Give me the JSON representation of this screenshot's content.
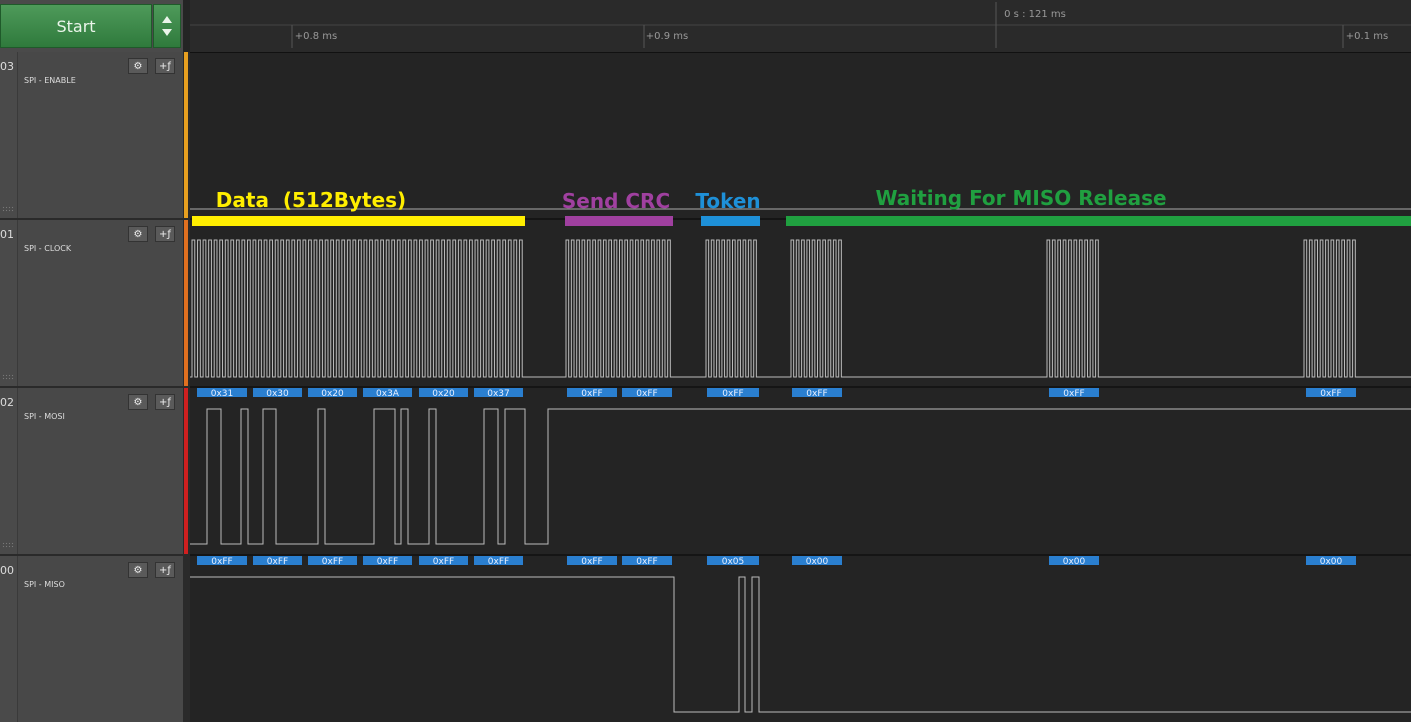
{
  "toolbar": {
    "start_label": "Start"
  },
  "timeline": {
    "absolute_time": "0 s : 121 ms",
    "ticks": [
      "+0.8 ms",
      "+0.9 ms",
      "+0.1 ms"
    ]
  },
  "channels": [
    {
      "index": "03",
      "name": "SPI - ENABLE"
    },
    {
      "index": "01",
      "name": "SPI - CLOCK"
    },
    {
      "index": "02",
      "name": "SPI - MOSI"
    },
    {
      "index": "00",
      "name": "SPI - MISO"
    }
  ],
  "annotations": [
    {
      "label": "Data  (512Bytes)",
      "color": "#ffee00"
    },
    {
      "label": "Send CRC",
      "color": "#a040a0"
    },
    {
      "label": "Token",
      "color": "#1e90d8"
    },
    {
      "label": "Waiting For MISO Release",
      "color": "#20a040"
    }
  ],
  "decoded": {
    "mosi": [
      "0x31",
      "0x30",
      "0x20",
      "0x3A",
      "0x20",
      "0x37",
      "0xFF",
      "0xFF",
      "0xFF",
      "0xFF",
      "0xFF",
      "0xFF"
    ],
    "miso": [
      "0xFF",
      "0xFF",
      "0xFF",
      "0xFF",
      "0xFF",
      "0xFF",
      "0xFF",
      "0xFF",
      "0x05",
      "0x00",
      "0x00",
      "0x00"
    ]
  },
  "colors": {
    "marker_enable": "#e8a020",
    "marker_clock": "#e07020",
    "marker_mosi": "#d02020",
    "decode_bubble": "#2a7fd0"
  },
  "icons": {
    "settings": "gear-icon",
    "trigger": "trigger-edge-icon"
  }
}
